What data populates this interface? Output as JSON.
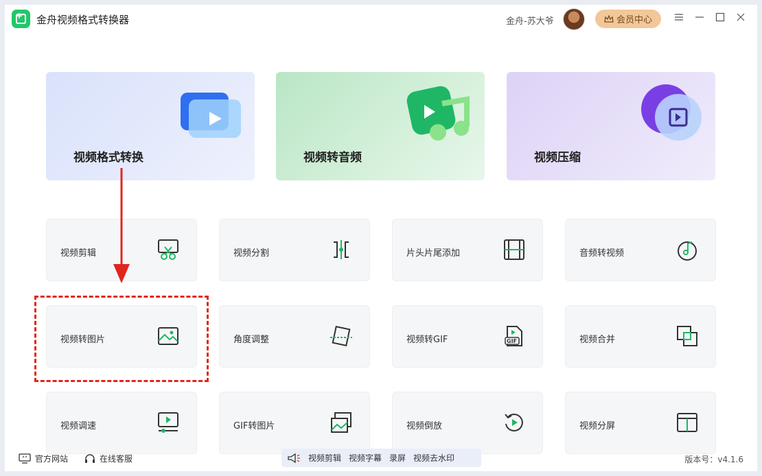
{
  "app": {
    "title": "金舟视频格式转换器"
  },
  "user": {
    "name": "金舟-苏大爷"
  },
  "header": {
    "vip_label": "会员中心"
  },
  "big_cards": [
    {
      "label": "视频格式转换"
    },
    {
      "label": "视频转音频"
    },
    {
      "label": "视频压缩"
    }
  ],
  "tools": [
    {
      "label": "视频剪辑"
    },
    {
      "label": "视频分割"
    },
    {
      "label": "片头片尾添加"
    },
    {
      "label": "音频转视频"
    },
    {
      "label": "视频转图片"
    },
    {
      "label": "角度调整"
    },
    {
      "label": "视频转GIF"
    },
    {
      "label": "视频合并"
    },
    {
      "label": "视频调速"
    },
    {
      "label": "GIF转图片"
    },
    {
      "label": "视频倒放"
    },
    {
      "label": "视频分屏"
    }
  ],
  "footer": {
    "website": "官方网站",
    "service": "在线客服",
    "quick": [
      "视频剪辑",
      "视频字幕",
      "录屏",
      "视频去水印"
    ],
    "version": "版本号：v4.1.6"
  },
  "colors": {
    "accent": "#22c76a",
    "highlight": "#e0261e",
    "vip": "#f2c79a"
  }
}
